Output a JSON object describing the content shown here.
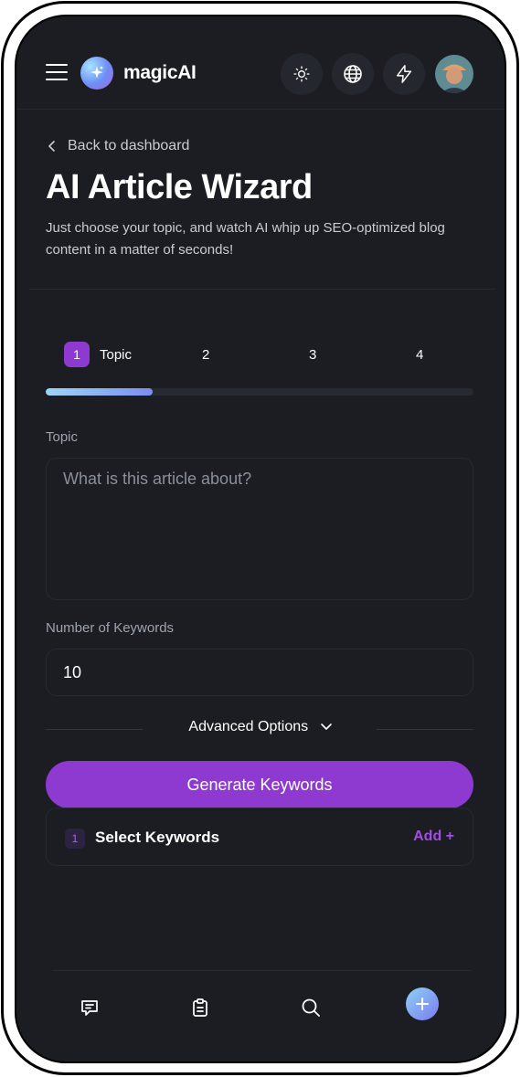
{
  "header": {
    "brand": "magicAI",
    "icons": [
      "menu-icon",
      "sparkle-icon",
      "sun-icon",
      "globe-icon",
      "lightning-icon",
      "avatar"
    ]
  },
  "page": {
    "back_label": "Back to dashboard",
    "title": "AI Article Wizard",
    "subtitle": "Just choose your topic, and watch AI whip up SEO-optimized blog content in a matter of seconds!"
  },
  "steps": {
    "items": [
      {
        "number": "1",
        "label": "Topic"
      },
      {
        "number": "2"
      },
      {
        "number": "3"
      },
      {
        "number": "4"
      }
    ],
    "progress": 0.25
  },
  "form": {
    "topic_label": "Topic",
    "topic_placeholder": "What is this article about?",
    "keywords_count_label": "Number of Keywords",
    "keywords_count_value": "10",
    "advanced_label": "Advanced Options",
    "generate_label": "Generate Keywords"
  },
  "keywords_card": {
    "number": "1",
    "title": "Select Keywords",
    "add_label": "Add +"
  },
  "bottom_nav": {
    "icons": [
      "chat-icon",
      "clipboard-icon",
      "search-icon",
      "plus-icon"
    ]
  },
  "colors": {
    "background": "#1b1d23",
    "accent": "#8e3ad0",
    "text": "#ffffff",
    "muted": "#9ea3ad"
  }
}
